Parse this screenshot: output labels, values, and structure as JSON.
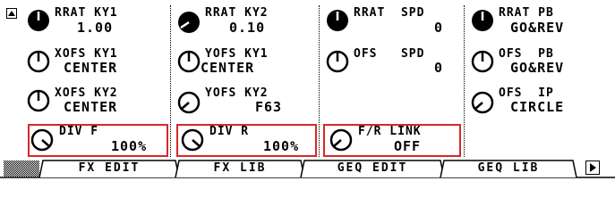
{
  "params": {
    "c1r1": {
      "name": "RRAT KY1",
      "value": "1.00"
    },
    "c1r2": {
      "name": "XOFS KY1",
      "value": "CENTER"
    },
    "c1r3": {
      "name": "XOFS KY2",
      "value": "CENTER"
    },
    "c1r4": {
      "name": "DIV F",
      "value": "100%"
    },
    "c2r1": {
      "name": "RRAT KY2",
      "value": "0.10"
    },
    "c2r2": {
      "name": "YOFS KY1",
      "value": "CENTER"
    },
    "c2r3": {
      "name": "YOFS KY2",
      "value": "F63"
    },
    "c2r4": {
      "name": "DIV R",
      "value": "100%"
    },
    "c3r1": {
      "name": "RRAT  SPD",
      "value": "0"
    },
    "c3r2": {
      "name": "OFS   SPD",
      "value": "0"
    },
    "c3r4": {
      "name": "F/R LINK",
      "value": "OFF"
    },
    "c4r1": {
      "name": "RRAT PB",
      "value": "GO&REV"
    },
    "c4r2": {
      "name": "OFS  PB",
      "value": "GO&REV"
    },
    "c4r3": {
      "name": "OFS  IP",
      "value": "CIRCLE"
    }
  },
  "tabs": [
    "FX EDIT",
    "FX LIB",
    "GEQ EDIT",
    "GEQ LIB"
  ],
  "colors": {
    "highlight": "#d62828",
    "ink": "#000000",
    "background": "#ffffff"
  },
  "icons": {
    "scroll": "scroll-up-arrow-icon",
    "next": "next-page-arrow-icon",
    "knob": "rotary-knob-icon"
  }
}
